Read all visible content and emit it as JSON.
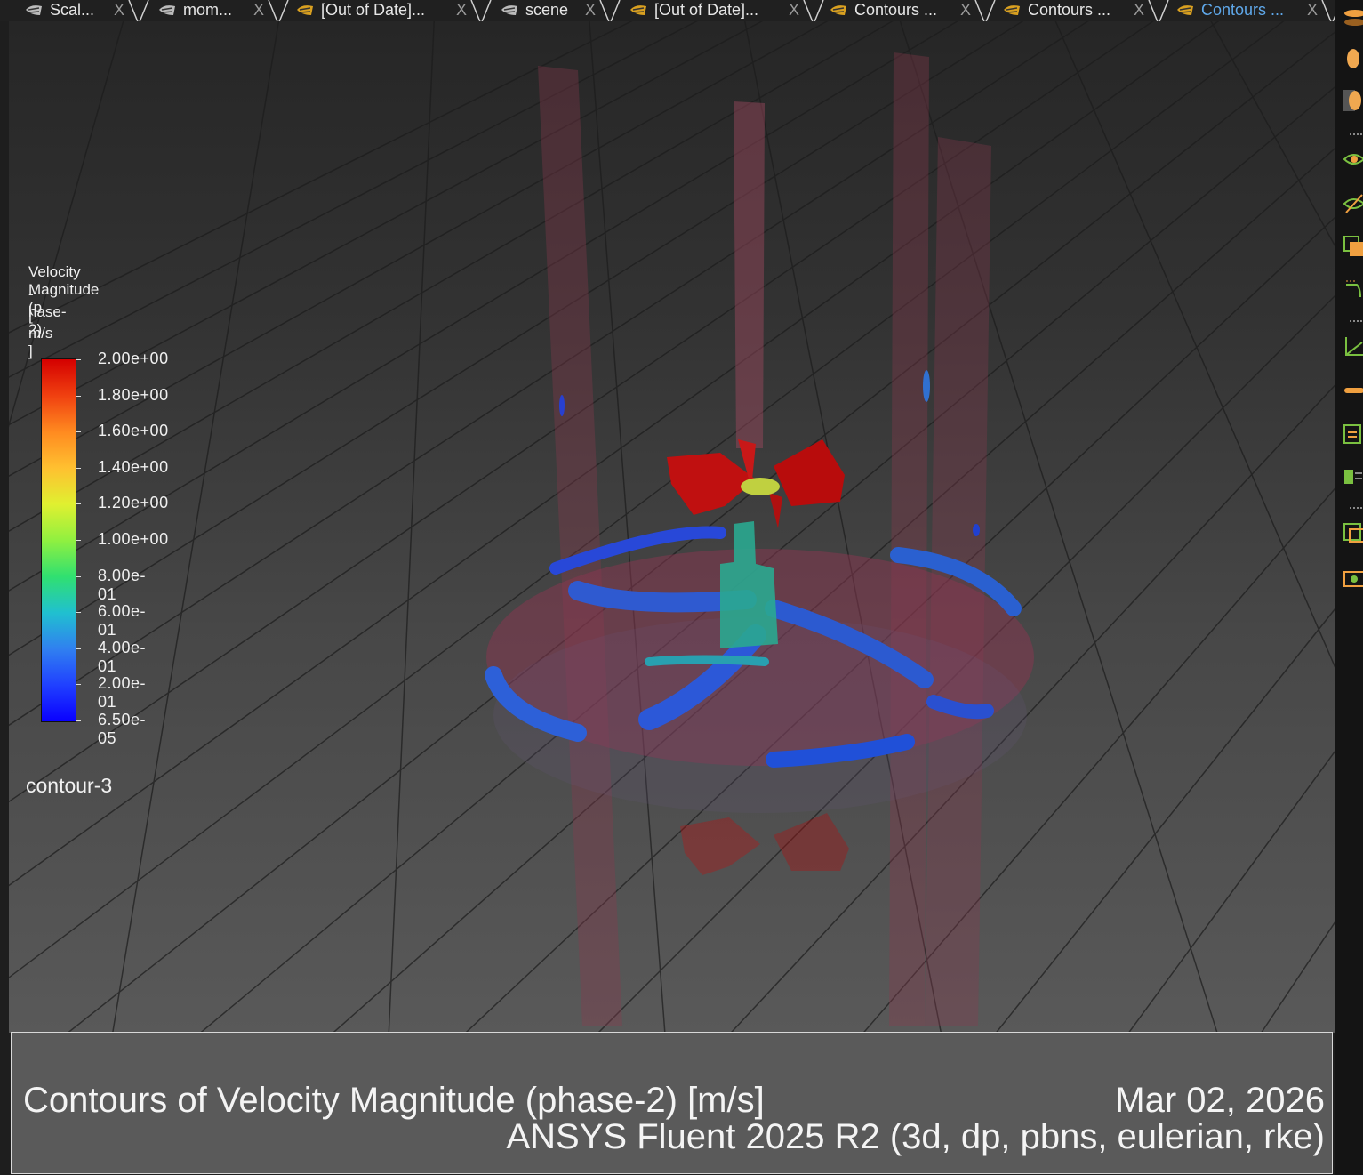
{
  "tabs": [
    {
      "label": "Scal...",
      "icon": "mesh-icon",
      "icon_color": "#bbbbbb",
      "active": false
    },
    {
      "label": "mom...",
      "icon": "mesh-icon",
      "icon_color": "#bbbbbb",
      "active": false
    },
    {
      "label": "[Out of Date]...",
      "icon": "mesh-icon",
      "icon_color": "#d9a020",
      "active": false
    },
    {
      "label": "scene",
      "icon": "mesh-icon",
      "icon_color": "#bbbbbb",
      "active": false
    },
    {
      "label": "[Out of Date]...",
      "icon": "mesh-icon",
      "icon_color": "#d9a020",
      "active": false
    },
    {
      "label": "Contours ...",
      "icon": "mesh-icon",
      "icon_color": "#d9a020",
      "active": false
    },
    {
      "label": "Contours ...",
      "icon": "mesh-icon",
      "icon_color": "#d9a020",
      "active": false
    },
    {
      "label": "Contours ...",
      "icon": "mesh-icon",
      "icon_color": "#d9a020",
      "active": true
    }
  ],
  "close_glyph": "X",
  "legend": {
    "title_lines": [
      "Velocity Magnitude (p",
      "-hase-2)",
      "[ m/s ]"
    ],
    "ticks": [
      "2.00e+00",
      "1.80e+00",
      "1.60e+00",
      "1.40e+00",
      "1.20e+00",
      "1.00e+00",
      "8.00e-01",
      "6.00e-01",
      "4.00e-01",
      "2.00e-01",
      "6.50e-05"
    ],
    "max_color": "#d40000",
    "min_color": "#0a00ff"
  },
  "contour_name": "contour-3",
  "footer": {
    "title": "Contours of Velocity Magnitude (phase-2)  [m/s]",
    "date": "Mar 02, 2026",
    "solver": "ANSYS Fluent 2025 R2 (3d, dp, pbns, eulerian, rke)"
  },
  "toolbar": {
    "tools": [
      "lights-icon",
      "headlight-icon",
      "lighting-mesh-icon",
      "show-icon",
      "hide-icon",
      "fit-window-icon",
      "rotate-view-icon",
      "axes-icon",
      "ruler-icon",
      "annotate-icon",
      "clip-icon",
      "views-icon",
      "snapshot-icon"
    ]
  }
}
